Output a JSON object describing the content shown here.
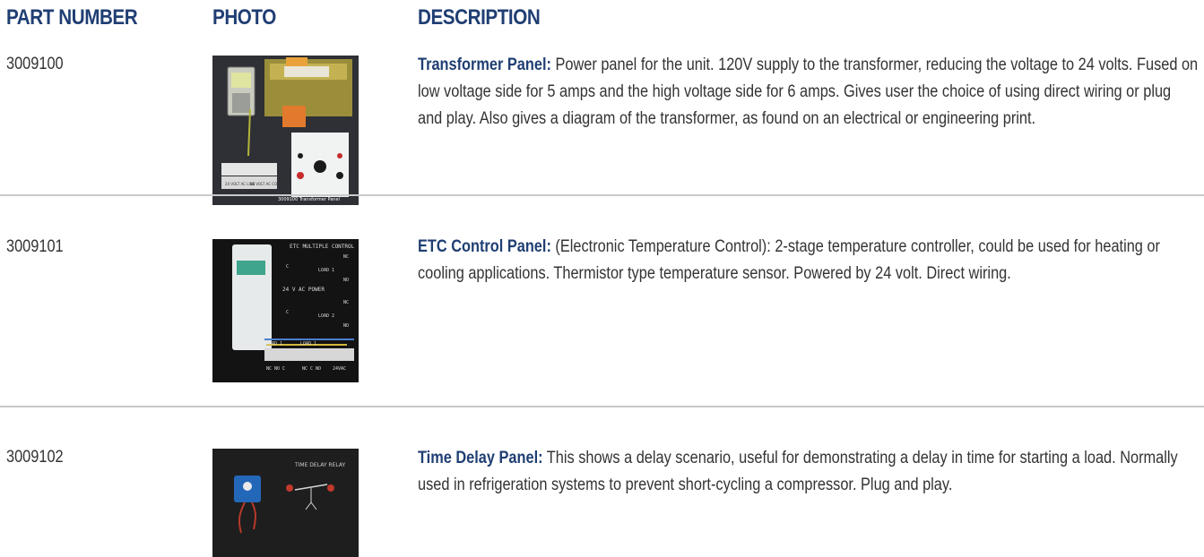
{
  "headers": {
    "part_number": "PART NUMBER",
    "photo": "PHOTO",
    "description": "DESCRIPTION"
  },
  "rows": [
    {
      "part_number": "3009100",
      "title": "Transformer Panel:",
      "description": " Power panel for the unit. 120V supply to the transformer, reducing the voltage to 24 volts. Fused on low voltage side for 5 amps and the high voltage side for 6 amps. Gives user the choice of using direct wiring or plug and play. Also gives a diagram of the transformer, as found on an electrical or engineering print.",
      "photo_caption": "3009100  Transformer Panel",
      "photo_labels": [
        "24 VOLT AC LINE",
        "24 VOLT AC COMMON"
      ]
    },
    {
      "part_number": "3009101",
      "title": "ETC Control Panel:",
      "description": " (Electronic Temperature Control): 2-stage temperature controller, could be used for heating or cooling applications. Thermistor type temperature sensor. Powered by 24 volt. Direct wiring.",
      "photo_labels": [
        "ETC MULTIPLE CONTROL",
        "NC",
        "C",
        "LOAD 1",
        "NO",
        "24 V AC POWER",
        "NC",
        "C",
        "LOAD 2",
        "NO",
        "LOAD 1",
        "LOAD 1",
        "NC NO C",
        "NC C NO",
        "24VAC"
      ]
    },
    {
      "part_number": "3009102",
      "title": "Time Delay Panel:",
      "description": " This shows a delay scenario, useful for demonstrating a delay in time for starting a load. Normally used in refrigeration systems to prevent short-cycling a compressor. Plug and play.",
      "photo_labels": [
        "TIME DELAY RELAY"
      ]
    }
  ]
}
